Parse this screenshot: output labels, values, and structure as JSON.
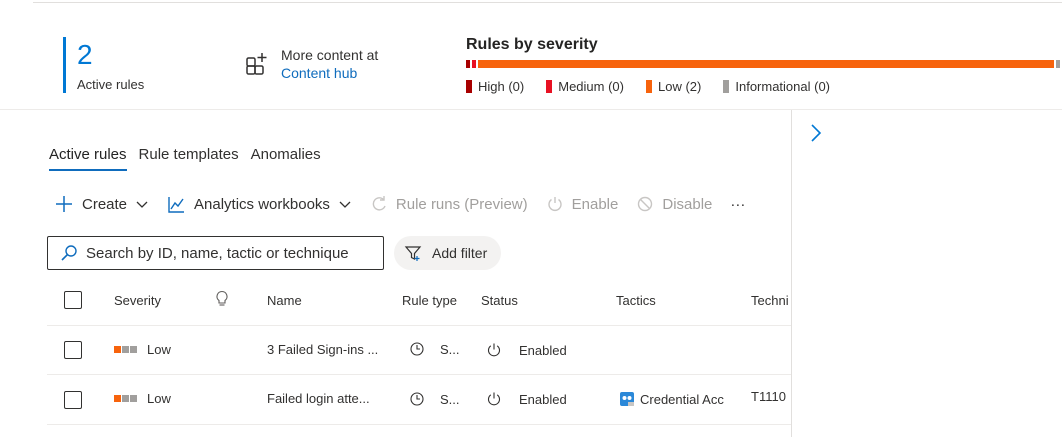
{
  "summary": {
    "active_count": "2",
    "active_label": "Active rules",
    "more_content_line1": "More content at",
    "more_content_link": "Content hub"
  },
  "severity": {
    "title": "Rules by severity",
    "counts": {
      "high": 0,
      "medium": 0,
      "low": 2,
      "informational": 0
    },
    "legend": [
      {
        "label": "High (0)",
        "color": "#a80000"
      },
      {
        "label": "Medium (0)",
        "color": "#e81123"
      },
      {
        "label": "Low (2)",
        "color": "#f7630c"
      },
      {
        "label": "Informational (0)",
        "color": "#a19f9d"
      }
    ]
  },
  "tabs": [
    {
      "label": "Active rules",
      "active": true
    },
    {
      "label": "Rule templates",
      "active": false
    },
    {
      "label": "Anomalies",
      "active": false
    }
  ],
  "toolbar": {
    "create": "Create",
    "workbooks": "Analytics workbooks",
    "rule_runs": "Rule runs (Preview)",
    "enable": "Enable",
    "disable": "Disable",
    "more": "···"
  },
  "search": {
    "placeholder": "Search by ID, name, tactic or technique"
  },
  "filter": {
    "label": "Add filter"
  },
  "table": {
    "columns": {
      "severity": "Severity",
      "name": "Name",
      "rule_type": "Rule type",
      "status": "Status",
      "tactics": "Tactics",
      "techniques": "Techni"
    },
    "rows": [
      {
        "severity": "Low",
        "name": "3 Failed Sign-ins ...",
        "rule_type": "S...",
        "status": "Enabled",
        "tactics": "",
        "techniques": ""
      },
      {
        "severity": "Low",
        "name": "Failed login atte...",
        "rule_type": "S...",
        "status": "Enabled",
        "tactics": "Credential Acc",
        "techniques": "T1110"
      }
    ]
  },
  "colors": {
    "accent": "#0078d4",
    "low": "#f7630c",
    "high": "#a80000",
    "medium": "#e81123",
    "informational": "#a19f9d"
  }
}
